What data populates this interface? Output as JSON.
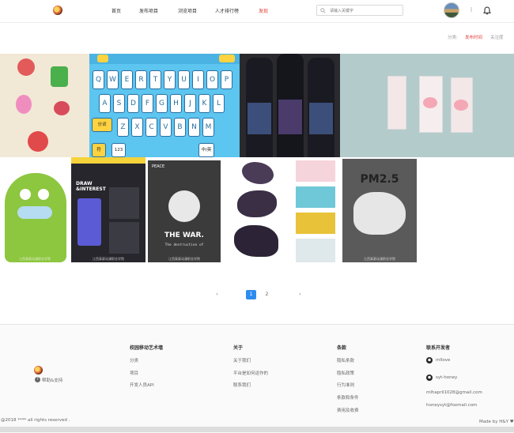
{
  "header": {
    "nav": [
      "首页",
      "发布项目",
      "浏览项目",
      "人才排行榜",
      "发现"
    ],
    "search_placeholder": "请输入关键字",
    "separator": "|"
  },
  "sort": {
    "label": "分类:",
    "options": [
      "发布时间",
      "关注度"
    ],
    "active": "发布时间"
  },
  "gallery": {
    "watermarks": [
      "江西泰豪动漫职业学院",
      "江西泰豪动漫职业学院",
      "江西泰豪动漫职业学院",
      "江西泰豪动漫职业学院"
    ],
    "keyboard_keys_row1": [
      "Q",
      "W",
      "E",
      "R",
      "T",
      "Y",
      "U",
      "I",
      "O",
      "P"
    ],
    "keyboard_keys_row2": [
      "A",
      "S",
      "D",
      "F",
      "G",
      "H",
      "J",
      "K",
      "L"
    ],
    "keyboard_keys_row3": [
      "Z",
      "X",
      "C",
      "V",
      "B",
      "N",
      "M"
    ],
    "keyboard_labels": {
      "fenci": "分词",
      "fu": "符",
      "num": "123",
      "zhongying": "中/英"
    },
    "poster_draw": "DRAW\n&INTEREST",
    "war_title": "THE WAR.",
    "war_sub": "The destruction of",
    "war_peace": "PEACE",
    "map_title": "PM2.5"
  },
  "pagination": {
    "prev": "‹",
    "pages": [
      "1",
      "2"
    ],
    "current": "1",
    "next": "›"
  },
  "footer": {
    "brand_link": "帮助&支持",
    "columns": [
      {
        "title": "校园移动艺术墙",
        "links": [
          "分类",
          "项目",
          "开发人员API"
        ]
      },
      {
        "title": "关于",
        "links": [
          "关于我们",
          "平台是如何运作的",
          "联系我们"
        ]
      },
      {
        "title": "条款",
        "links": [
          "隐私条款",
          "隐私政策",
          "行为准则",
          "条款和条件",
          "费用及收费"
        ]
      },
      {
        "title": "联系开发者",
        "links": [
          "mllove",
          "syt-honey",
          "mlhapril1028@gmail.com",
          "honeysyt@foxmail.com"
        ]
      }
    ],
    "copyright": "@2018 **** all rights reserved .",
    "made_by": "Made by H&Y ♥"
  },
  "colors": {
    "accent": "#e0403a",
    "primary": "#2d8cf0"
  }
}
